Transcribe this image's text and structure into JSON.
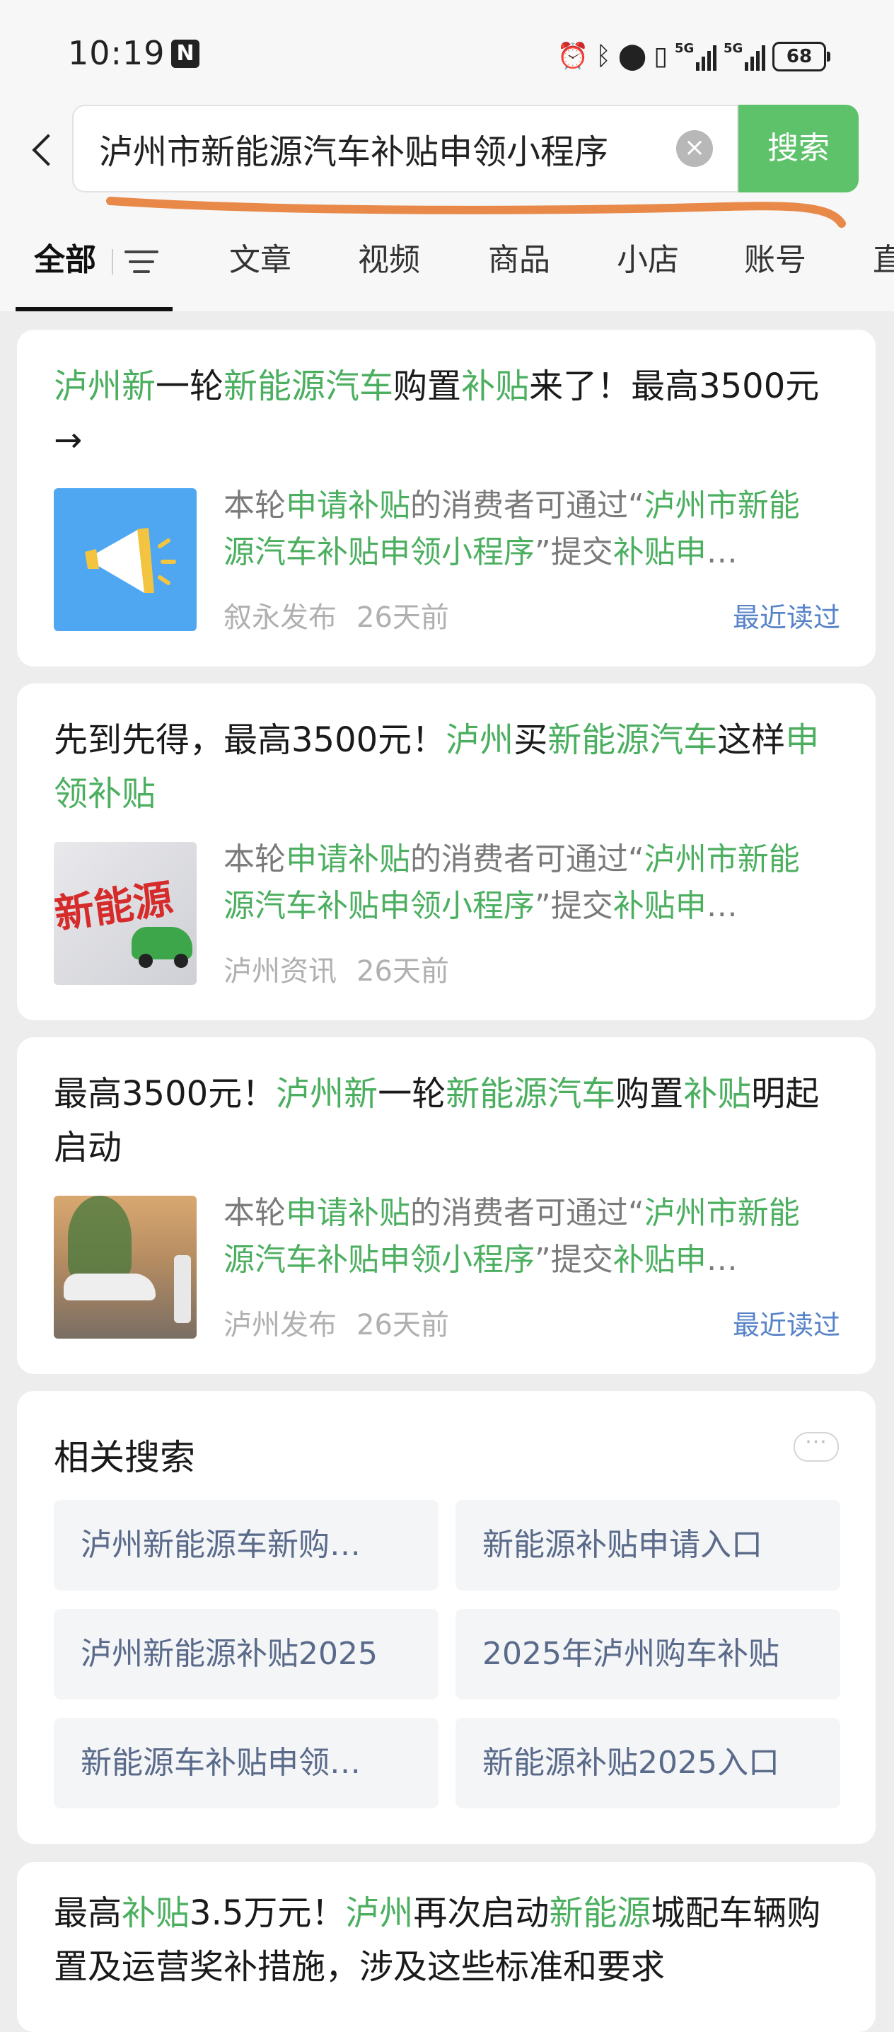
{
  "status_bar": {
    "time": "10:19",
    "nfc_icon": "N",
    "signal_label_1": "5G",
    "signal_label_2": "5G",
    "battery": "68"
  },
  "search": {
    "query": "泸州市新能源汽车补贴申领小程序",
    "button_label": "搜索"
  },
  "tabs": [
    {
      "label": "全部"
    },
    {
      "label": "文章"
    },
    {
      "label": "视频"
    },
    {
      "label": "商品"
    },
    {
      "label": "小店"
    },
    {
      "label": "账号"
    },
    {
      "label": "直"
    }
  ],
  "results": [
    {
      "title_parts": [
        {
          "t": "泸州新",
          "hl": true
        },
        {
          "t": "一轮",
          "hl": false
        },
        {
          "t": "新能源汽车",
          "hl": true
        },
        {
          "t": "购置",
          "hl": false
        },
        {
          "t": "补贴",
          "hl": true
        },
        {
          "t": "来了！最高3500元→",
          "hl": false
        }
      ],
      "snippet_parts": [
        {
          "t": "本轮",
          "hl": false
        },
        {
          "t": "申请补贴",
          "hl": true
        },
        {
          "t": "的消费者可通过“",
          "hl": false
        },
        {
          "t": "泸州市新能源汽车补贴申领小程序",
          "hl": true
        },
        {
          "t": "”提交",
          "hl": false
        },
        {
          "t": "补贴申",
          "hl": true
        },
        {
          "t": "…",
          "hl": false
        }
      ],
      "source": "叙永发布",
      "time": "26天前",
      "badge": "最近读过",
      "thumb_icon": "megaphone-icon"
    },
    {
      "title_parts": [
        {
          "t": "先到先得，最高3500元！",
          "hl": false
        },
        {
          "t": "泸州",
          "hl": true
        },
        {
          "t": "买",
          "hl": false
        },
        {
          "t": "新能源汽车",
          "hl": true
        },
        {
          "t": "这样",
          "hl": false
        },
        {
          "t": "申领补贴",
          "hl": true
        }
      ],
      "snippet_parts": [
        {
          "t": "本轮",
          "hl": false
        },
        {
          "t": "申请补贴",
          "hl": true
        },
        {
          "t": "的消费者可通过“",
          "hl": false
        },
        {
          "t": "泸州市新能源汽车补贴申领小程序",
          "hl": true
        },
        {
          "t": "”提交",
          "hl": false
        },
        {
          "t": "补贴申",
          "hl": true
        },
        {
          "t": "…",
          "hl": false
        }
      ],
      "source": "泸州资讯",
      "time": "26天前",
      "badge": "",
      "thumb_text": "新能源"
    },
    {
      "title_parts": [
        {
          "t": "最高3500元！",
          "hl": false
        },
        {
          "t": "泸州新",
          "hl": true
        },
        {
          "t": "一轮",
          "hl": false
        },
        {
          "t": "新能源汽车",
          "hl": true
        },
        {
          "t": "购置",
          "hl": false
        },
        {
          "t": "补贴",
          "hl": true
        },
        {
          "t": "明起启动",
          "hl": false
        }
      ],
      "snippet_parts": [
        {
          "t": "本轮",
          "hl": false
        },
        {
          "t": "申请补贴",
          "hl": true
        },
        {
          "t": "的消费者可通过“",
          "hl": false
        },
        {
          "t": "泸州市新能源汽车补贴申领小程序",
          "hl": true
        },
        {
          "t": "”提交",
          "hl": false
        },
        {
          "t": "补贴申",
          "hl": true
        },
        {
          "t": "…",
          "hl": false
        }
      ],
      "source": "泸州发布",
      "time": "26天前",
      "badge": "最近读过"
    }
  ],
  "related": {
    "title": "相关搜索",
    "more": "···",
    "items": [
      "泸州新能源车新购…",
      "新能源补贴申请入口",
      "泸州新能源补贴2025",
      "2025年泸州购车补贴",
      "新能源车补贴申领…",
      "新能源补贴2025入口"
    ]
  },
  "last_result": {
    "title_parts": [
      {
        "t": "最高",
        "hl": false
      },
      {
        "t": "补贴",
        "hl": true
      },
      {
        "t": "3.5万元！",
        "hl": false
      },
      {
        "t": "泸州",
        "hl": true
      },
      {
        "t": "再次启动",
        "hl": false
      },
      {
        "t": "新能源",
        "hl": true
      },
      {
        "t": "城配车辆购置及运营奖补措施，涉及这些标准和要求",
        "hl": false
      }
    ]
  },
  "colors": {
    "accent_green": "#5ec26a",
    "highlight_green": "#4caf60",
    "link_blue": "#5783c8",
    "annotation_orange": "#e8894a"
  }
}
